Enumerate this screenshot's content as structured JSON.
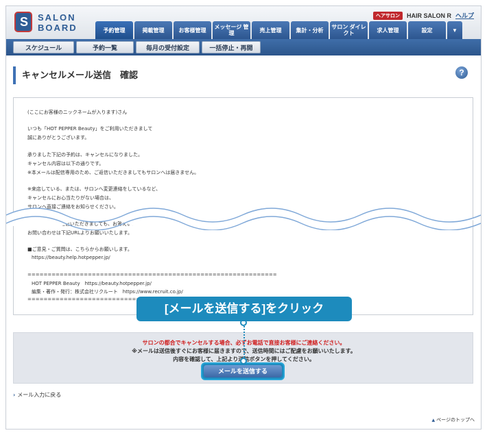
{
  "header": {
    "logo_mark": "S",
    "logo_line1": "SALON",
    "logo_line2": "BOARD",
    "badge": "ヘアサロン",
    "salon_name": "HAIR SALON R",
    "help": "ヘルプ",
    "tabs": [
      {
        "label": "予約管理"
      },
      {
        "label": "掲載管理"
      },
      {
        "label": "お客様管理"
      },
      {
        "label": "メッセージ 管理"
      },
      {
        "label": "売上管理"
      },
      {
        "label": "集計・分析"
      },
      {
        "label": "サロン ダイレクト"
      },
      {
        "label": "求人管理"
      },
      {
        "label": "設定"
      }
    ]
  },
  "subnav": [
    "スケジュール",
    "予約一覧",
    "毎月の受付設定",
    "一括停止・再開"
  ],
  "page_title": "キャンセルメール送信　確認",
  "help_icon": "?",
  "mail_lines": [
    "(ここにお客様のニックネームが入ります)さん",
    "いつも「HOT PEPPER Beauty」をご利用いただきまして",
    "誠にありがとうございます。",
    "承りました下記の予約は、キャンセルになりました。",
    "キャンセル内容は以下の通りです。",
    "※本メールは配信専用のため、ご返信いただきましてもサロンへは届きません。",
    "※来店している、または、サロンへ変更連絡をしているなど、",
    "キャンセルにお心当たりがない場合は、",
    "サロンへ直接ご連絡をお知らせください。",
    "※本メールにご返信いただきましても、お答えいたしかねます。",
    "お問い合わせは下記URLよりお願いいたします。",
    "■ご意見・ご質問は、こちらからお願いします。",
    "https://beauty.help.hotpepper.jp/",
    "==============================================================",
    "HOT PEPPER Beauty　https://beauty.hotpepper.jp/",
    "編集・著作・発行：株式会社リクルート　https://www.recruit.co.jp/",
    "=============================================================="
  ],
  "warnings": {
    "red": "サロンの都合でキャンセルする場合、必ずお電話で直接お客様にご連絡ください。",
    "line2": "※メールは送信後すぐにお客様に届きますので、送信時間にはご配慮をお願いいたします。",
    "line3": "内容を確認して、上記より送信ボタンを押してください。"
  },
  "send_button": "メールを送信する",
  "callout": "[メールを送信する]をクリック",
  "back_link": "メール入力に戻る",
  "top_link": "ページのトップへ",
  "colors": {
    "brand": "#2f5d95",
    "accent": "#1d8bbd",
    "warning": "#d01f1f"
  }
}
